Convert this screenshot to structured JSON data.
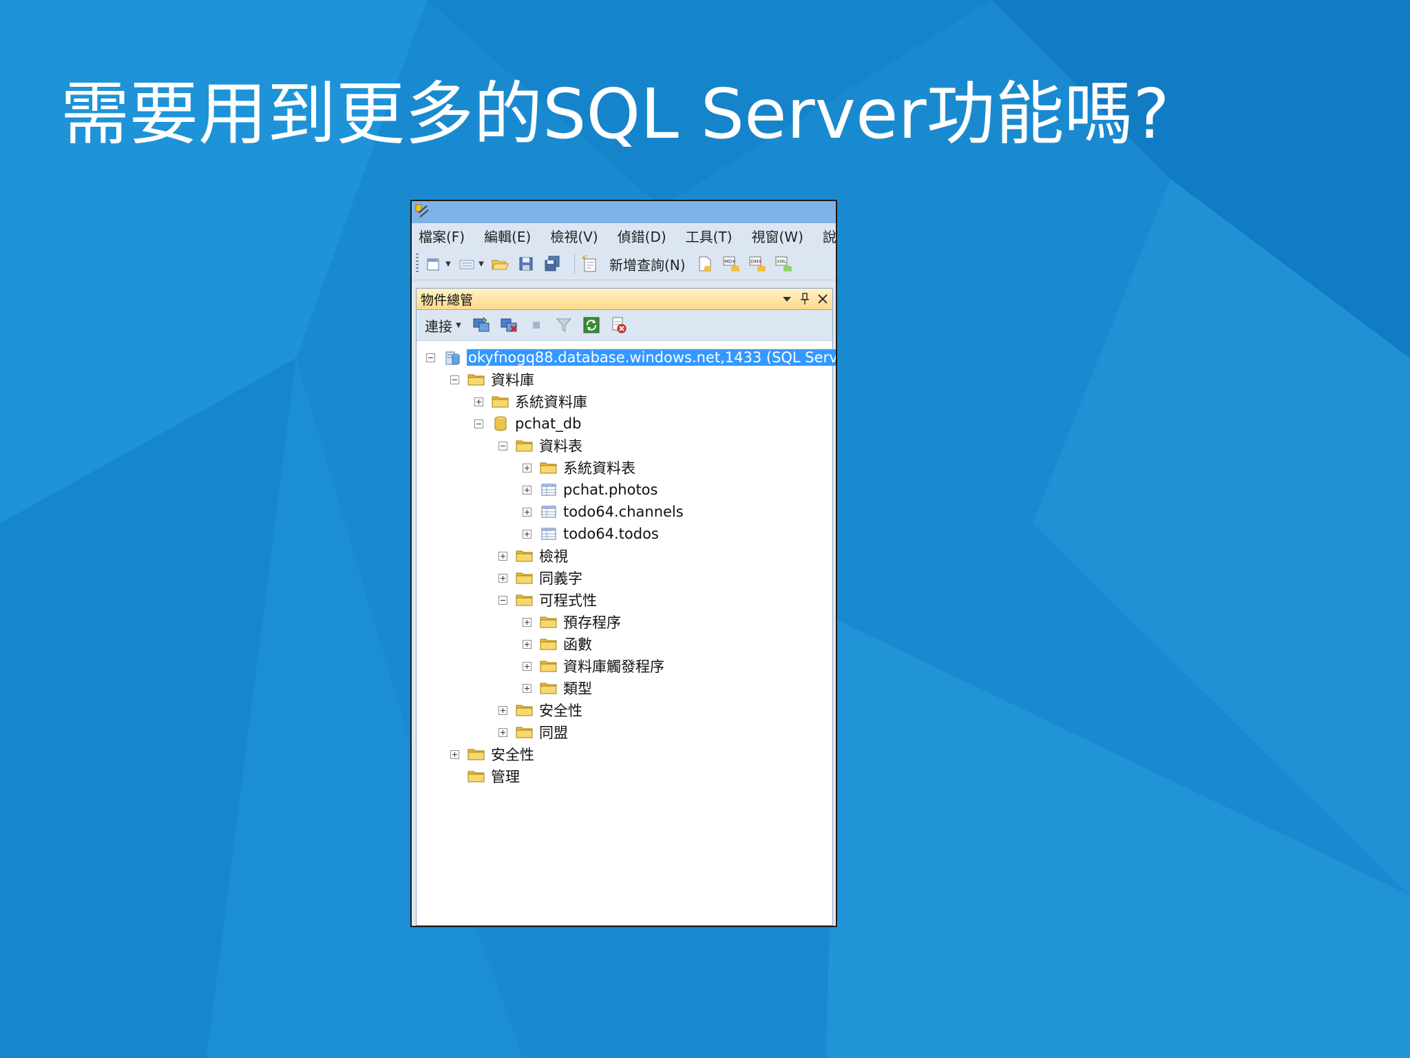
{
  "slide": {
    "title": "需要用到更多的SQL Server功能嗎?"
  },
  "window": {
    "menu": [
      "檔案(F)",
      "編輯(E)",
      "檢視(V)",
      "偵錯(D)",
      "工具(T)",
      "視窗(W)",
      "說"
    ],
    "toolbar": {
      "new_query_label": "新增查詢(N)"
    }
  },
  "object_explorer": {
    "title": "物件總管",
    "connect_label": "連接",
    "tree": [
      {
        "label": "okyfnogq88.database.windows.net,1433 (SQL Serv",
        "icon": "server-icon",
        "expander": "minus",
        "selected": true
      },
      {
        "label": "資料庫",
        "icon": "folder-icon",
        "expander": "minus"
      },
      {
        "label": "系統資料庫",
        "icon": "folder-icon",
        "expander": "plus"
      },
      {
        "label": "pchat_db",
        "icon": "database-icon",
        "expander": "minus"
      },
      {
        "label": "資料表",
        "icon": "folder-icon",
        "expander": "minus"
      },
      {
        "label": "系統資料表",
        "icon": "folder-icon",
        "expander": "plus"
      },
      {
        "label": "pchat.photos",
        "icon": "table-icon",
        "expander": "plus"
      },
      {
        "label": "todo64.channels",
        "icon": "table-icon",
        "expander": "plus"
      },
      {
        "label": "todo64.todos",
        "icon": "table-icon",
        "expander": "plus"
      },
      {
        "label": "檢視",
        "icon": "folder-icon",
        "expander": "plus"
      },
      {
        "label": "同義字",
        "icon": "folder-icon",
        "expander": "plus"
      },
      {
        "label": "可程式性",
        "icon": "folder-icon",
        "expander": "minus"
      },
      {
        "label": "預存程序",
        "icon": "folder-icon",
        "expander": "plus"
      },
      {
        "label": "函數",
        "icon": "folder-icon",
        "expander": "plus"
      },
      {
        "label": "資料庫觸發程序",
        "icon": "folder-icon",
        "expander": "plus"
      },
      {
        "label": "類型",
        "icon": "folder-icon",
        "expander": "plus"
      },
      {
        "label": "安全性",
        "icon": "folder-icon",
        "expander": "plus"
      },
      {
        "label": "同盟",
        "icon": "folder-icon",
        "expander": "plus"
      },
      {
        "label": "安全性",
        "icon": "folder-icon",
        "expander": "plus"
      },
      {
        "label": "管理",
        "icon": "folder-icon",
        "expander": "none"
      }
    ]
  },
  "colors": {
    "background": "#1a8ad0",
    "selection": "#3399ff",
    "panel_header": "#ffd98a"
  }
}
